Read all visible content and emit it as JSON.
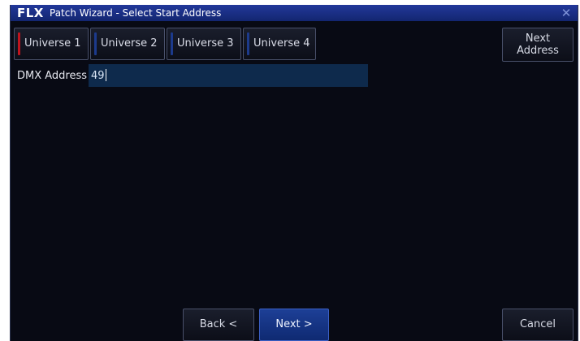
{
  "titlebar": {
    "brand": "FLX",
    "title": "Patch Wizard - Select Start Address",
    "close_glyph": "✕"
  },
  "tabs": [
    {
      "label": "Universe 1",
      "stripe_color": "#c0141e",
      "selected": true
    },
    {
      "label": "Universe 2",
      "stripe_color": "#1c3a8c",
      "selected": false
    },
    {
      "label": "Universe 3",
      "stripe_color": "#1c3a8c",
      "selected": false
    },
    {
      "label": "Universe 4",
      "stripe_color": "#1c3a8c",
      "selected": false
    }
  ],
  "next_address": {
    "line1": "Next",
    "line2": "Address"
  },
  "dmx": {
    "label": "DMX Address",
    "value": "49"
  },
  "footer": {
    "back_label": "Back <",
    "next_label": "Next >",
    "cancel_label": "Cancel"
  },
  "colors": {
    "window_bg": "#080a14",
    "titlebar": "#1a2f86",
    "field_bg": "#0e2a4c",
    "accent_button": "#1d3f96"
  }
}
